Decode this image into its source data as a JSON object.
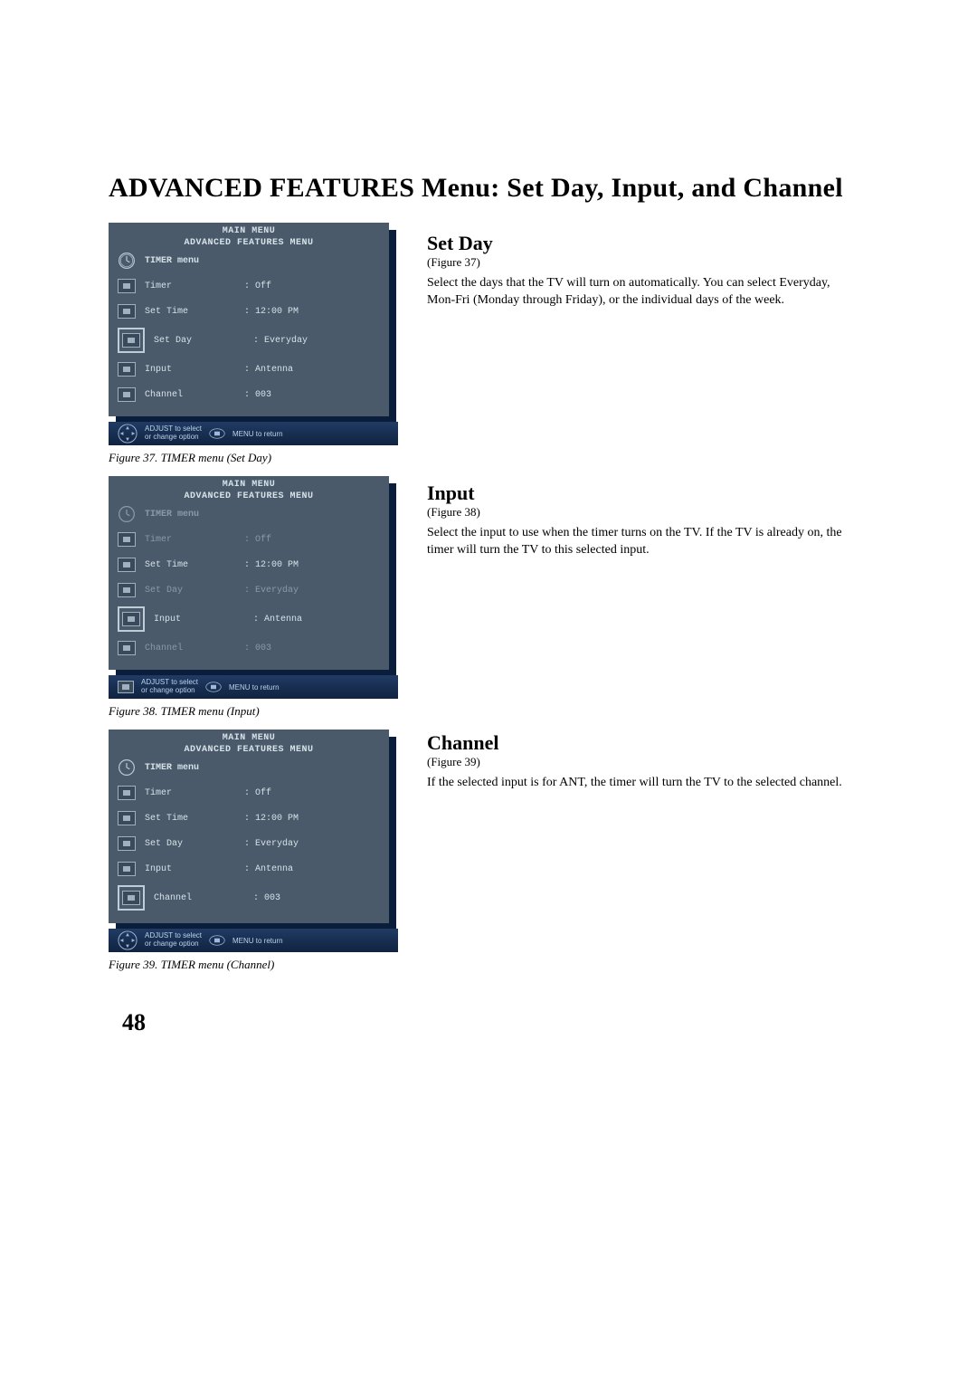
{
  "page_title": "ADVANCED FEATURES Menu: Set Day, Input, and Channel",
  "page_number": "48",
  "menu_common": {
    "main_menu": "MAIN MENU",
    "adv_menu": "ADVANCED FEATURES MENU",
    "title": "TIMER menu",
    "rows": {
      "timer_label": "Timer",
      "timer_value": ": Off",
      "settime_label": "Set Time",
      "settime_value": ": 12:00 PM",
      "setday_label": "Set Day",
      "setday_value": ": Everyday",
      "input_label": "Input",
      "input_value": ": Antenna",
      "channel_label": "Channel",
      "channel_value": ": 003"
    },
    "instr_line1": "ADJUST to select",
    "instr_line2": "or change option",
    "instr_menu": "MENU to return"
  },
  "captions": {
    "fig37": "Figure 37.  TIMER menu (Set Day)",
    "fig38": "Figure 38.  TIMER menu (Input)",
    "fig39": "Figure 39.  TIMER menu (Channel)"
  },
  "sections": {
    "setday": {
      "head": "Set Day",
      "ref": "(Figure 37)",
      "body": "Select the days that the TV will turn on automatically.  You can select Everyday, Mon-Fri (Monday through Friday), or the individual days of the week."
    },
    "input": {
      "head": "Input",
      "ref": "(Figure 38)",
      "body": "Select the input to use when the timer turns on the TV.  If the TV is already on, the timer will turn the TV to this selected input."
    },
    "channel": {
      "head": "Channel",
      "ref": "(Figure 39)",
      "body": "If the selected input is for ANT, the timer will turn the TV to the selected channel."
    }
  }
}
